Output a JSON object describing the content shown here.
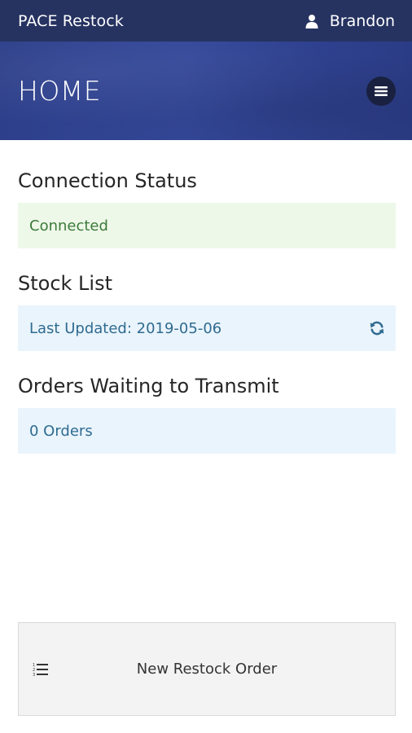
{
  "topbar": {
    "app_title": "PACE Restock",
    "user_name": "Brandon",
    "user_icon": "user-icon"
  },
  "hero": {
    "title": "HOME",
    "menu_icon": "hamburger-menu-icon"
  },
  "sections": {
    "connection": {
      "heading": "Connection Status",
      "status": "Connected",
      "color": "#3c7a3a",
      "bg": "#eef8e9"
    },
    "stock": {
      "heading": "Stock List",
      "last_updated": "Last Updated: 2019-05-06",
      "action_icon": "refresh-icon"
    },
    "orders": {
      "heading": "Orders Waiting to Transmit",
      "count_text": "0 Orders"
    }
  },
  "bottom_action": {
    "label": "New Restock Order",
    "icon": "list-icon"
  },
  "colors": {
    "topbar": "#263361",
    "hero": "#2d3f8a",
    "info_text": "#2e6b90",
    "info_bg": "#eaf4fc"
  }
}
